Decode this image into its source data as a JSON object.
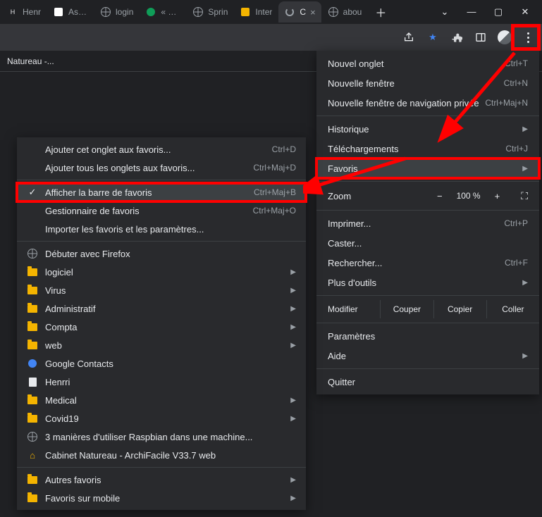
{
  "tabs": [
    {
      "label": "Henr",
      "favicon": "text"
    },
    {
      "label": "Assis",
      "favicon": "white"
    },
    {
      "label": "login",
      "favicon": "globe"
    },
    {
      "label": "« Bou",
      "favicon": "green"
    },
    {
      "label": "Sprin",
      "favicon": "globe"
    },
    {
      "label": "Inter",
      "favicon": "yellow"
    },
    {
      "label": "C",
      "favicon": "spinner",
      "active": true,
      "close": true
    },
    {
      "label": "abou",
      "favicon": "globe"
    }
  ],
  "bookmark_bar_item": "Natureau -...",
  "main_menu": {
    "new_tab": "Nouvel onglet",
    "new_tab_sc": "Ctrl+T",
    "new_window": "Nouvelle fenêtre",
    "new_window_sc": "Ctrl+N",
    "new_incognito": "Nouvelle fenêtre de navigation privée",
    "new_incognito_sc": "Ctrl+Maj+N",
    "history": "Historique",
    "downloads": "Téléchargements",
    "downloads_sc": "Ctrl+J",
    "bookmarks": "Favoris",
    "zoom_label": "Zoom",
    "zoom_value": "100 %",
    "print": "Imprimer...",
    "print_sc": "Ctrl+P",
    "cast": "Caster...",
    "find": "Rechercher...",
    "find_sc": "Ctrl+F",
    "more_tools": "Plus d'outils",
    "modify": "Modifier",
    "cut": "Couper",
    "copy": "Copier",
    "paste": "Coller",
    "settings": "Paramètres",
    "help": "Aide",
    "quit": "Quitter"
  },
  "sub_menu": {
    "add_tab": "Ajouter cet onglet aux favoris...",
    "add_tab_sc": "Ctrl+D",
    "add_all": "Ajouter tous les onglets aux favoris...",
    "add_all_sc": "Ctrl+Maj+D",
    "show_bar": "Afficher la barre de favoris",
    "show_bar_sc": "Ctrl+Maj+B",
    "manager": "Gestionnaire de favoris",
    "manager_sc": "Ctrl+Maj+O",
    "import": "Importer les favoris et les paramètres...",
    "firefox": "Débuter avec Firefox",
    "logiciel": "logiciel",
    "virus": "Virus",
    "admin": "Administratif",
    "compta": "Compta",
    "web": "web",
    "contacts": "Google Contacts",
    "henrri": "Henrri",
    "medical": "Medical",
    "covid": "Covid19",
    "raspbian": "3 manières d'utiliser Raspbian dans une machine...",
    "cabinet": "Cabinet Natureau - ArchiFacile V33.7 web",
    "other": "Autres favoris",
    "mobile": "Favoris sur mobile"
  }
}
